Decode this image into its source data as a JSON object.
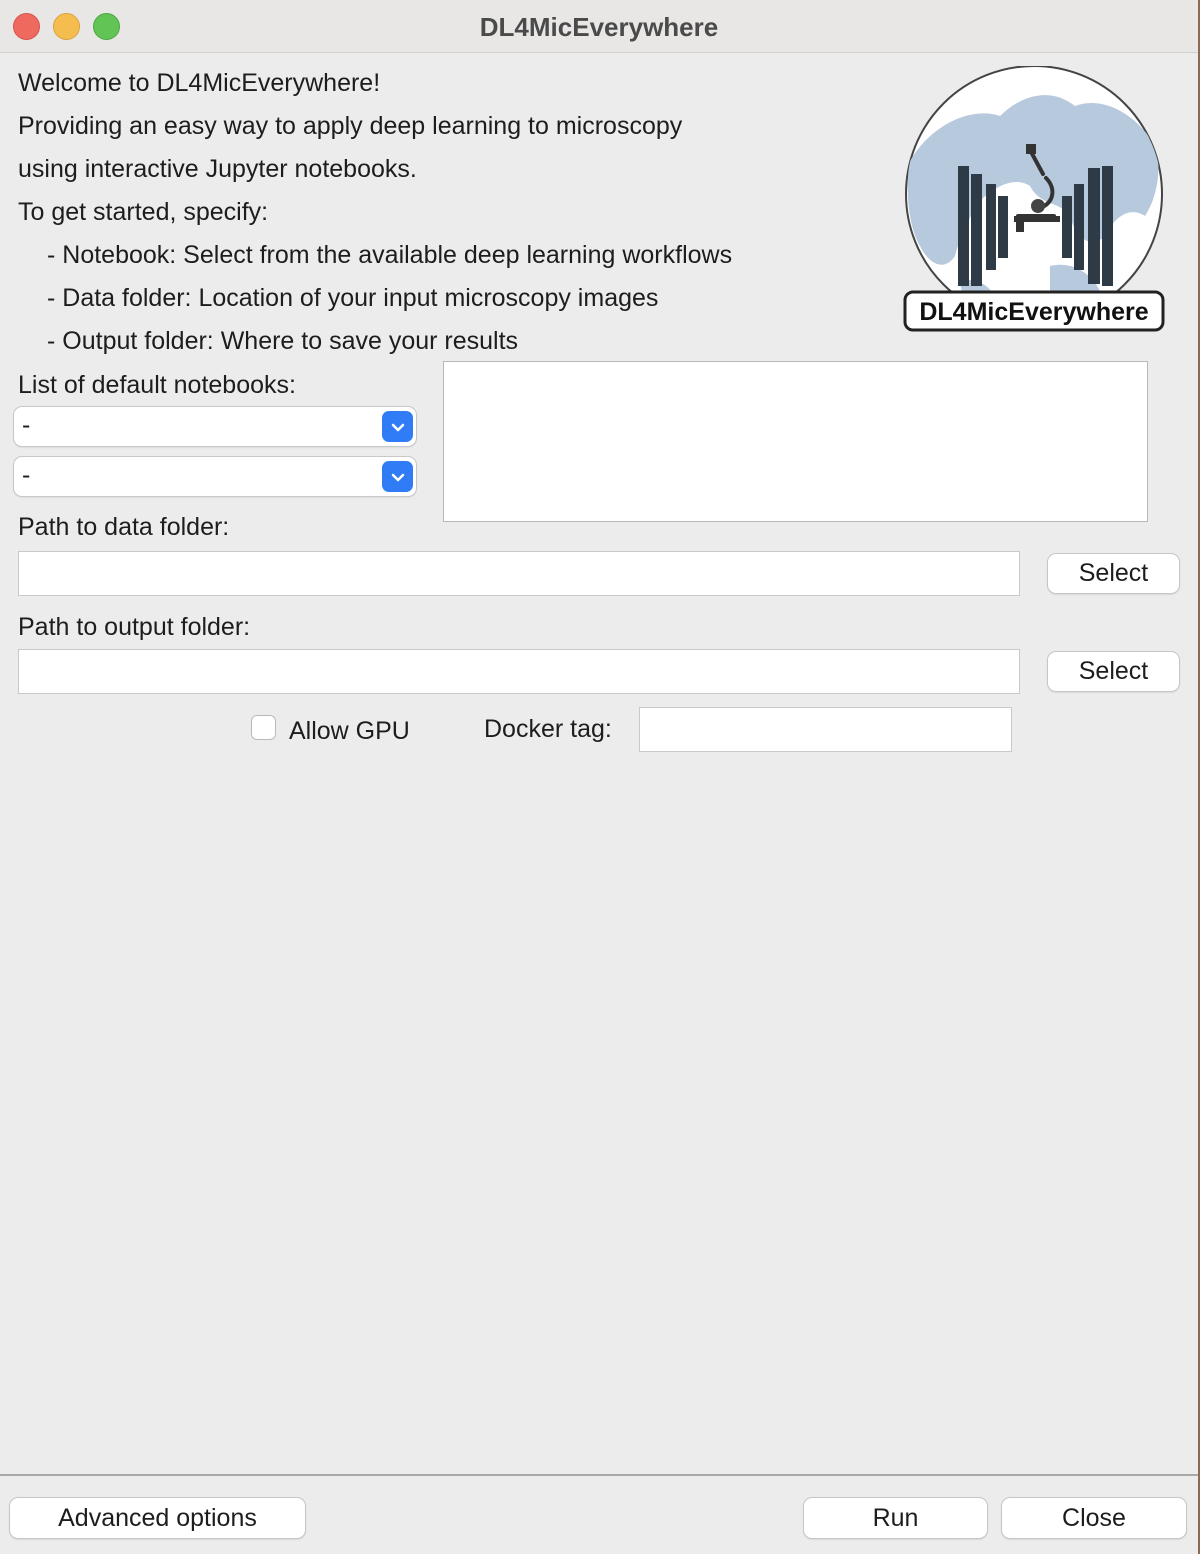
{
  "window": {
    "title": "DL4MicEverywhere"
  },
  "intro": {
    "lines": [
      "Welcome to DL4MicEverywhere!",
      "Providing an easy way to apply deep learning to microscopy",
      "using interactive Jupyter notebooks.",
      "To get started, specify:",
      "- Notebook: Select from the available deep learning workflows",
      "- Data folder: Location of your input microscopy images",
      "- Output folder: Where to save your results"
    ]
  },
  "logo": {
    "text": "DL4MicEverywhere",
    "icon": "microscope-globe-logo"
  },
  "notebooks": {
    "label": "List of default notebooks:",
    "combo1_value": "-",
    "combo2_value": "-"
  },
  "data_folder": {
    "label": "Path to data folder:",
    "value": "",
    "select_label": "Select"
  },
  "output_folder": {
    "label": "Path to output folder:",
    "value": "",
    "select_label": "Select"
  },
  "options": {
    "gpu_label": "Allow GPU",
    "gpu_checked": false,
    "docker_tag_label": "Docker tag:",
    "docker_tag_value": ""
  },
  "footer": {
    "advanced_label": "Advanced options",
    "run_label": "Run",
    "close_label": "Close"
  },
  "colors": {
    "accent": "#2f7cf6",
    "background": "#ececec",
    "close": "#ee6a5f",
    "minimize": "#f5bd4f",
    "maximize": "#61c454"
  }
}
